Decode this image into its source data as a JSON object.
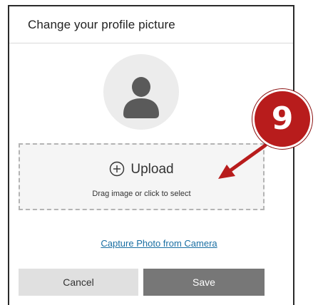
{
  "dialog": {
    "title": "Change your profile picture"
  },
  "avatar": {
    "icon": "person-icon"
  },
  "dropzone": {
    "upload_icon": "plus-circle-icon",
    "upload_label": "Upload",
    "hint": "Drag image or click to select"
  },
  "camera": {
    "link_label": "Capture Photo from Camera"
  },
  "buttons": {
    "cancel_label": "Cancel",
    "save_label": "Save"
  },
  "annotation": {
    "number": "9",
    "color": "#b81c1c"
  },
  "colors": {
    "link": "#1a6fa3",
    "save_button": "#777777",
    "cancel_button": "#e0e0e0"
  }
}
